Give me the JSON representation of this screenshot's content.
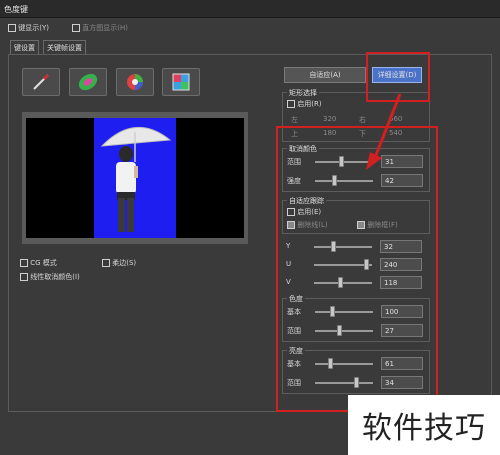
{
  "window": {
    "title": "色度键"
  },
  "top_options": {
    "key_display": "键显示(Y)",
    "histogram": "直方图显示(H)"
  },
  "tabs": [
    "键设置",
    "关键帧设置"
  ],
  "tools": [
    "eyedropper-icon",
    "color-ellipse-icon",
    "color-wheel-icon",
    "color-square-icon"
  ],
  "buttons": {
    "auto_adapt": "自适应(A)",
    "detail": "详细设置(D)"
  },
  "rect_select": {
    "title": "矩形选择",
    "enable": "启用(R)",
    "left_label": "左",
    "left_value": "320",
    "right_label": "右",
    "right_value": "560",
    "top_label": "上",
    "top_value": "180",
    "bottom_label": "下",
    "bottom_value": "540"
  },
  "cancel_color": {
    "title": "取消颜色",
    "range_label": "范围",
    "range_value": "31",
    "range_level": 0.45,
    "strength_label": "强度",
    "strength_value": "42",
    "strength_level": 0.33
  },
  "auto_track": {
    "title": "自适应跟踪",
    "enable": "启用(E)",
    "linear": "删除线(L)",
    "fixed": "删除框(F)",
    "y_label": "Y",
    "y_value": "32",
    "y_level": 0.33,
    "u_label": "U",
    "u_value": "240",
    "u_level": 0.94,
    "v_label": "V",
    "v_value": "118",
    "v_level": 0.46
  },
  "hue": {
    "title": "色度",
    "base_label": "基本",
    "base_value": "100",
    "base_level": 0.28,
    "range_label": "范围",
    "range_value": "27",
    "range_level": 0.42
  },
  "brightness": {
    "title": "亮度",
    "base_label": "基本",
    "base_value": "61",
    "base_level": 0.24,
    "range_label": "范围",
    "range_value": "34",
    "range_level": 0.73
  },
  "bottom_options": {
    "cg_mode": "CG 模式",
    "soft_edge": "柔边(S)",
    "linear_cancel": "线性取消颜色(I)"
  },
  "watermark": "软件技巧"
}
